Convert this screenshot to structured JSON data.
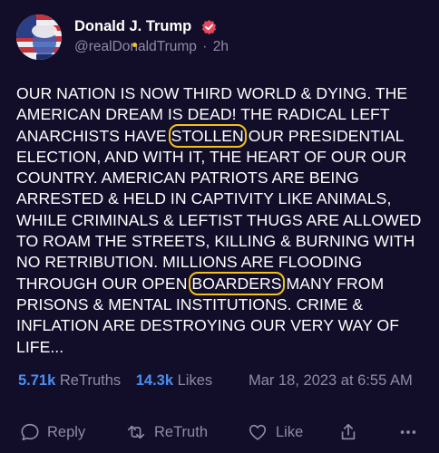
{
  "post": {
    "author_name": "Donald J. Trump",
    "handle": "@realDonaldTrump",
    "separator": "·",
    "age": "2h",
    "text_parts": [
      "OUR NATION IS NOW THIRD WORLD & DYING. THE AMERICAN DREAM IS DEAD! THE RADICAL LEFT ANARCHISTS HAVE ",
      "STOLLEN",
      " OUR PRESIDENTIAL ELECTION, AND WITH IT, THE HEART OF OUR OUR COUNTRY. AMERICAN PATRIOTS ARE BEING ARRESTED & HELD IN CAPTIVITY LIKE ANIMALS, WHILE CRIMINALS & LEFTIST THUGS ARE ALLOWED TO ROAM THE STREETS, KILLING & BURNING WITH NO RETRIBUTION. MILLIONS ARE FLOODING THROUGH OUR OPEN ",
      "BOARDERS",
      " MANY FROM PRISONS & MENTAL INSTITUTIONS. CRIME & INFLATION ARE DESTROYING OUR VERY WAY OF LIFE..."
    ],
    "highlight_color": "#f1c11c"
  },
  "stats": {
    "retruths_count": "5.71k",
    "retruths_label": "ReTruths",
    "likes_count": "14.3k",
    "likes_label": "Likes",
    "timestamp": "Mar 18, 2023 at 6:55 AM"
  },
  "actions": {
    "reply": "Reply",
    "retruth": "ReTruth",
    "like": "Like"
  },
  "colors": {
    "background": "#120e2a",
    "accent_blue": "#4a90f2",
    "muted": "#8f8aa6",
    "verified": "#e5485d"
  },
  "icons": [
    "avatar-image",
    "verified-badge-icon",
    "reply-icon",
    "retruth-icon",
    "like-icon",
    "share-icon",
    "more-icon"
  ]
}
